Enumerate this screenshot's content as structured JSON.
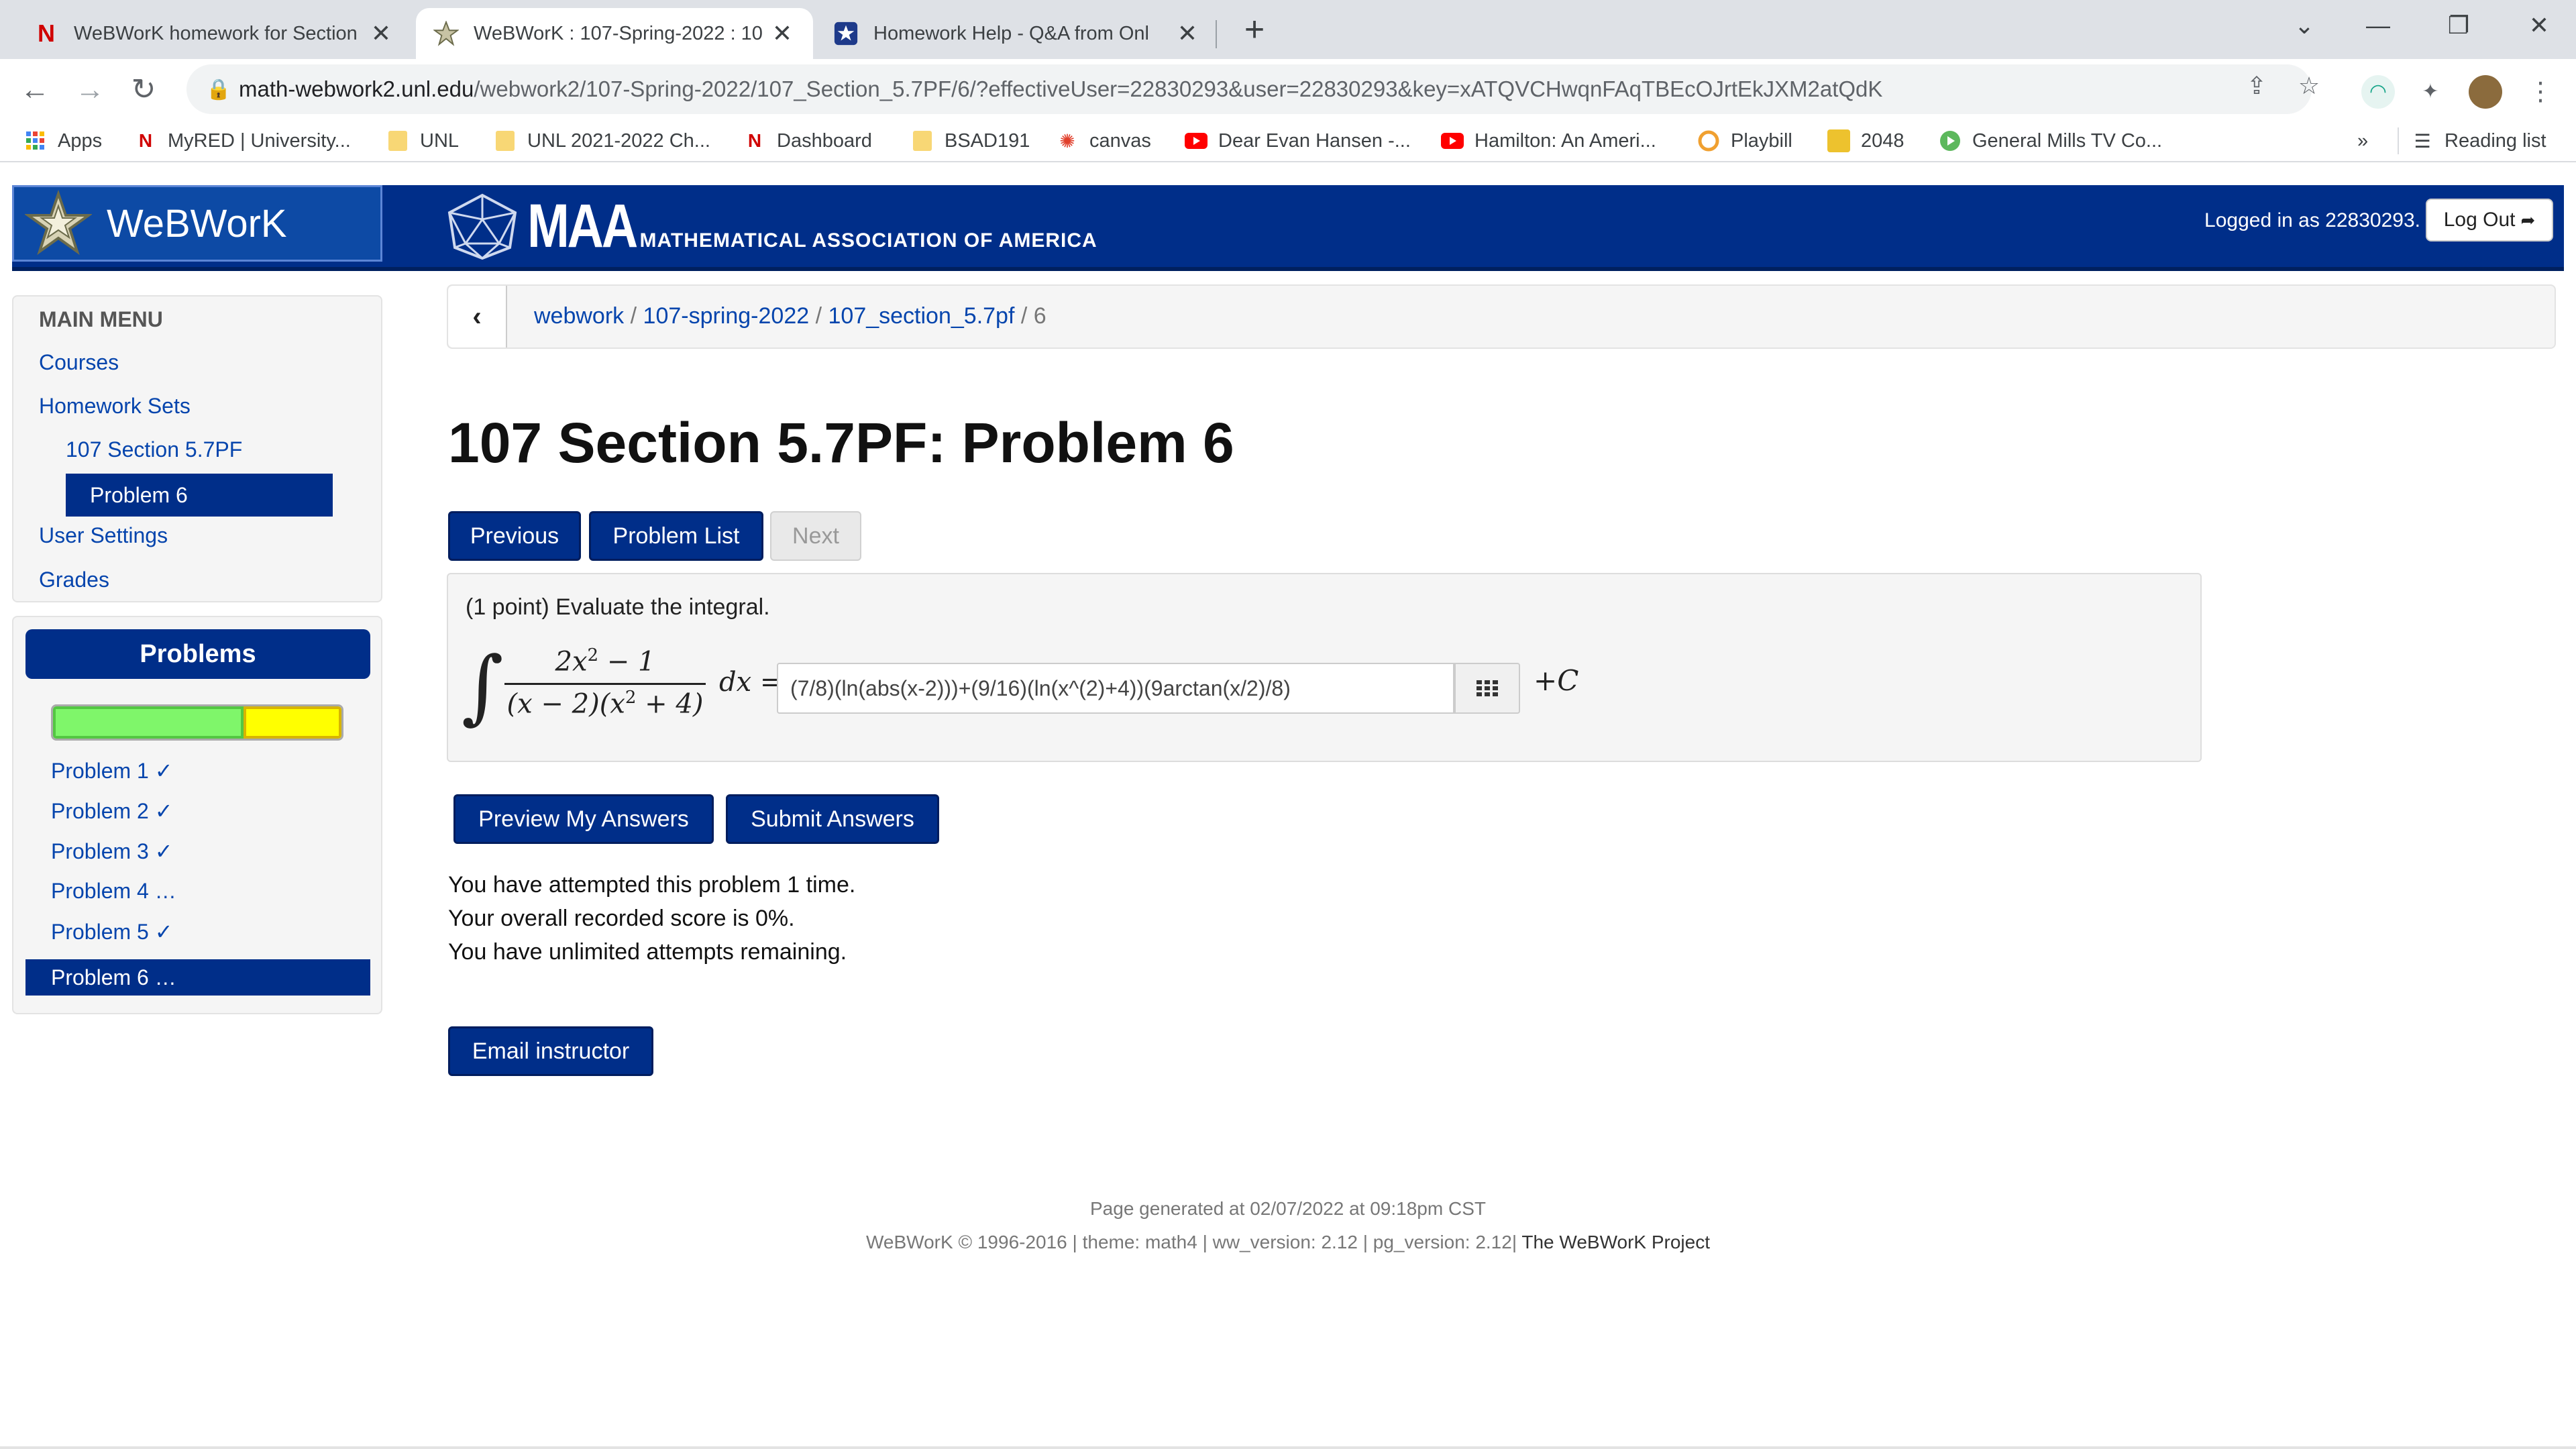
{
  "browser": {
    "tabs": [
      {
        "title": "WeBWorK homework for Section",
        "favicon": "N"
      },
      {
        "title": "WeBWorK : 107-Spring-2022 : 10",
        "favicon": "webwork-star"
      },
      {
        "title": "Homework Help - Q&A from Onl",
        "favicon": "star-badge"
      }
    ],
    "url_host": "math-webwork2.unl.edu",
    "url_path": "/webwork2/107-Spring-2022/107_Section_5.7PF/6/?effectiveUser=22830293&user=22830293&key=xATQVCHwqnFAqTBEcOJrtEkJXM2atQdK",
    "bookmarks": [
      {
        "label": "Apps"
      },
      {
        "label": "MyRED | University..."
      },
      {
        "label": "UNL"
      },
      {
        "label": "UNL 2021-2022 Ch..."
      },
      {
        "label": "Dashboard"
      },
      {
        "label": "BSAD191"
      },
      {
        "label": "canvas"
      },
      {
        "label": "Dear Evan Hansen -..."
      },
      {
        "label": "Hamilton: An Ameri..."
      },
      {
        "label": "Playbill"
      },
      {
        "label": "2048"
      },
      {
        "label": "General Mills TV Co..."
      }
    ],
    "more_bookmarks": "»",
    "reading_list": "Reading list"
  },
  "header": {
    "brand": "WeBWorK",
    "maa_word": "MAA",
    "maa_sub": "MATHEMATICAL ASSOCIATION OF AMERICA",
    "logged_in": "Logged in as 22830293.",
    "logout": "Log Out"
  },
  "main_menu": {
    "title": "MAIN MENU",
    "items": [
      "Courses",
      "Homework Sets",
      "107 Section 5.7PF",
      "Problem 6",
      "User Settings",
      "Grades"
    ]
  },
  "problems_panel": {
    "title": "Problems",
    "progress": {
      "correct_fraction": 0.667,
      "incorrect_fraction": 0.333
    },
    "items": [
      "Problem 1 ✓",
      "Problem 2 ✓",
      "Problem 3 ✓",
      "Problem 4 …",
      "Problem 5 ✓",
      "Problem 6 …"
    ]
  },
  "breadcrumb": {
    "items": [
      "webwork",
      "107-spring-2022",
      "107_section_5.7pf"
    ],
    "current": "6"
  },
  "page_title": "107 Section 5.7PF: Problem 6",
  "nav_buttons": {
    "previous": "Previous",
    "problem_list": "Problem List",
    "next": "Next"
  },
  "problem": {
    "statement": "(1 point) Evaluate the integral.",
    "answer_value": "(7/8)(ln(abs(x-2)))+(9/16)(ln(x^(2)+4))(9arctan(x/2)/8)",
    "plus_c": "+C"
  },
  "action_buttons": {
    "preview": "Preview My Answers",
    "submit": "Submit Answers"
  },
  "status": {
    "attempts": "You have attempted this problem 1 time.",
    "score": "Your overall recorded score is 0%.",
    "remaining": "You have unlimited attempts remaining."
  },
  "email_button": "Email instructor",
  "footer": {
    "generated": "Page generated at 02/07/2022 at 09:18pm CST",
    "copyright": "WeBWorK © 1996-2016 | theme: math4 | ww_version: 2.12 | pg_version: 2.12|",
    "project_link": "The WeBWorK Project"
  }
}
